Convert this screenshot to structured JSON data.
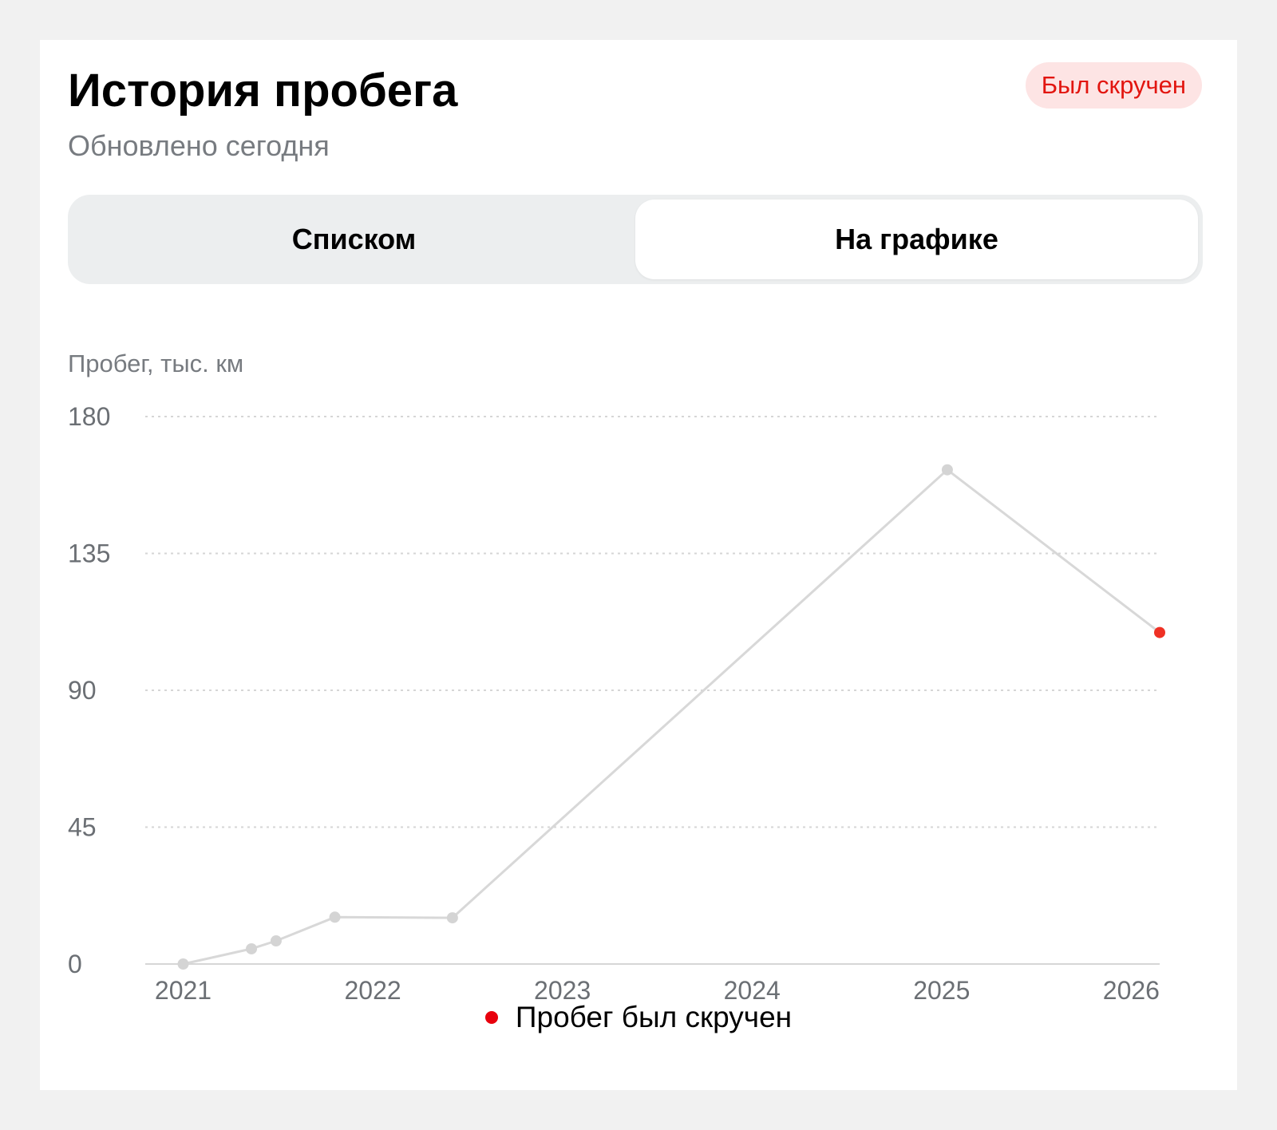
{
  "card": {
    "title": "История пробега",
    "subtitle": "Обновлено сегодня",
    "badge": "Был скручен"
  },
  "colors": {
    "badge_bg": "#fde4e4",
    "badge_text": "#e2150f",
    "line": "#d8d8d8",
    "point": "#d4d4d4",
    "rollback_point": "#ef3124",
    "legend_dot": "#e8000d",
    "grid": "#d6d6d6",
    "tick_text": "#6b6f74"
  },
  "tabs": [
    {
      "label": "Списком",
      "selected": false
    },
    {
      "label": "На графике",
      "selected": true
    }
  ],
  "chart_data": {
    "type": "line",
    "ylabel": "Пробег, тыс. км",
    "xlabel": "",
    "y_ticks": [
      0,
      45,
      90,
      135,
      180
    ],
    "ylim": [
      0,
      180
    ],
    "x_ticks": [
      "2021",
      "2022",
      "2023",
      "2024",
      "2025",
      "2026"
    ],
    "xlim": [
      2020.8,
      2026.15
    ],
    "grid": "horizontal dotted",
    "series": [
      {
        "points": [
          {
            "x": 2021.0,
            "y": 0,
            "rolled_back": false
          },
          {
            "x": 2021.36,
            "y": 5,
            "rolled_back": false
          },
          {
            "x": 2021.49,
            "y": 7.6,
            "rolled_back": false
          },
          {
            "x": 2021.8,
            "y": 15.4,
            "rolled_back": false
          },
          {
            "x": 2022.42,
            "y": 15.2,
            "rolled_back": false
          },
          {
            "x": 2025.03,
            "y": 162.5,
            "rolled_back": false
          },
          {
            "x": 2026.15,
            "y": 109,
            "rolled_back": true
          }
        ]
      }
    ],
    "legend": {
      "label": "Пробег был скручен",
      "placement": "bottom-center"
    }
  }
}
